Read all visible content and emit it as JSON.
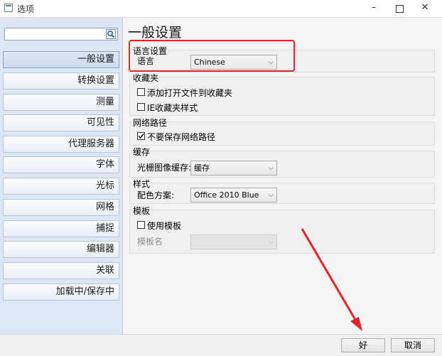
{
  "window": {
    "title": "选项",
    "minimize": "–",
    "close": "✕"
  },
  "sidebar": {
    "search_value": "",
    "items": [
      {
        "label": "一般设置"
      },
      {
        "label": "转换设置"
      },
      {
        "label": "测量"
      },
      {
        "label": "可见性"
      },
      {
        "label": "代理服务器"
      },
      {
        "label": "字体"
      },
      {
        "label": "光标"
      },
      {
        "label": "网格"
      },
      {
        "label": "捕捉"
      },
      {
        "label": "编辑器"
      },
      {
        "label": "关联"
      },
      {
        "label": "加载中/保存中"
      }
    ]
  },
  "main": {
    "title": "一般设置",
    "language": {
      "group": "语言设置",
      "label": "语言",
      "value": "Chinese"
    },
    "favorites": {
      "group": "收藏夹",
      "add_open_file": "添加打开文件到收藏夹",
      "ie_style": "IE收藏夹样式",
      "add_checked": false,
      "ie_checked": false
    },
    "network": {
      "group": "网络路径",
      "no_save": "不要保存网络路径",
      "checked": true
    },
    "cache": {
      "group": "缓存",
      "label": "光栅图像缓存:",
      "value": "缓存"
    },
    "style": {
      "group": "样式",
      "label": "配色方案:",
      "value": "Office 2010 Blue"
    },
    "template": {
      "group": "模板",
      "use_template": "使用模板",
      "checked": false,
      "name_label": "模板名",
      "name_value": ""
    }
  },
  "footer": {
    "ok": "好",
    "cancel": "取消"
  },
  "colors": {
    "highlight": "#e3242b",
    "sidebar_bg": "#dce6f4"
  }
}
